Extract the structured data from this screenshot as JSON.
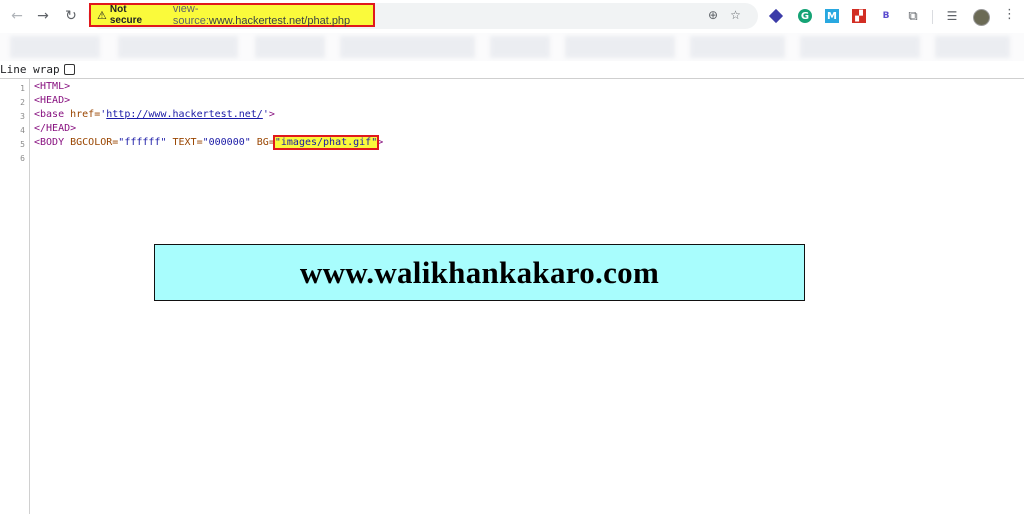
{
  "toolbar": {
    "back_icon": "←",
    "forward_icon": "→",
    "reload_icon": "↻",
    "security_icon": "⚠",
    "security_label": "Not secure",
    "url_prefix": "view-source:",
    "url": "www.hackertest.net/phat.php",
    "zoom_icon": "⊕",
    "star_icon": "☆",
    "menu_icon": "⋮"
  },
  "view_source": {
    "line_wrap_label": "Line wrap",
    "line_numbers": [
      "1",
      "2",
      "3",
      "4",
      "5",
      "6"
    ],
    "lines": {
      "l1": "<HTML>",
      "l2": "<HEAD>",
      "l3_tag_open": "<base ",
      "l3_attr": "href=",
      "l3_q1": "'",
      "l3_link": "http://www.hackertest.net/",
      "l3_q2": "'",
      "l3_close": ">",
      "l4": "</HEAD>",
      "l5_tag_open": "<BODY ",
      "l5_attr1": "BGCOLOR=",
      "l5_val1": "\"ffffff\"",
      "l5_attr2": " TEXT=",
      "l5_val2": "\"000000\"",
      "l5_attr3": " BG=",
      "l5_q1": "\"",
      "l5_val3": "images/phat.gif",
      "l5_q2": "\"",
      "l5_close": ">"
    }
  },
  "watermark": "www.walikhankakaro.com",
  "colors": {
    "highlight": "#fafa3b",
    "highlight_border": "#e0181c",
    "banner_bg": "#a8fdfd",
    "tag": "#881280",
    "attr": "#994500",
    "value": "#1a1aa6"
  }
}
